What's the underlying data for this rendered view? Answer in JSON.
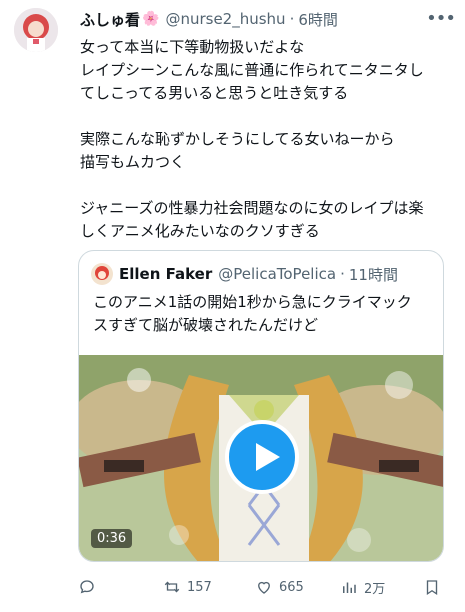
{
  "author": {
    "name": "ふしゅ看",
    "flower_icon": "flower-emoji",
    "handle": "@nurse2_hushu",
    "separator": "·",
    "time": "6時間"
  },
  "more_icon": "more-horizontal-icon",
  "tweet_text": "女って本当に下等動物扱いだよな\nレイプシーンこんな風に普通に作られてニタニタし\nてしこってる男いると思うと吐き気する\n\n実際こんな恥ずかしそうにしてる女いねーから\n描写もムカつく\n\nジャニーズの性暴力社会問題なのに女のレイプは楽\nしくアニメ化みたいなのクソすぎる",
  "quote": {
    "name": "Ellen Faker",
    "handle": "@PelicaToPelica",
    "separator": "·",
    "time": "11時間",
    "text": "このアニメ1話の開始1秒から急にクライマック\nスすぎて脳が破壊されたんだけど",
    "video_duration": "0:36"
  },
  "actions": {
    "reply_count": "",
    "retweet_count": "157",
    "like_count": "665",
    "views_count": "2万"
  },
  "colors": {
    "text": "#0f1419",
    "secondary": "#536471",
    "accent": "#1d9bf0",
    "border": "#cfd9de"
  }
}
